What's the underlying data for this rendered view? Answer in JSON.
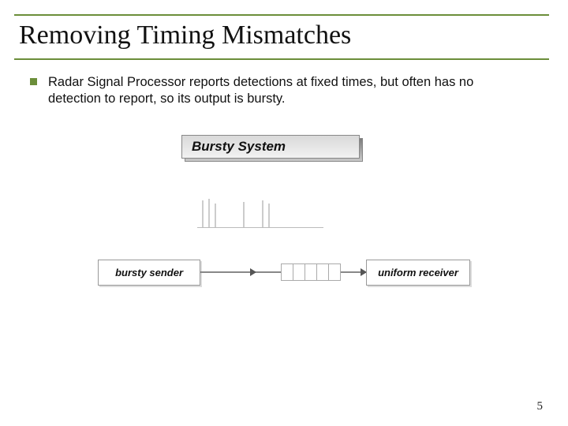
{
  "title": "Removing Timing Mismatches",
  "bullet": "Radar Signal Processor reports detections at fixed times, but often has no detection to report, so its output is bursty.",
  "diagram": {
    "system_label": "Bursty System",
    "sender": "bursty sender",
    "receiver": "uniform receiver"
  },
  "page_number": "5"
}
